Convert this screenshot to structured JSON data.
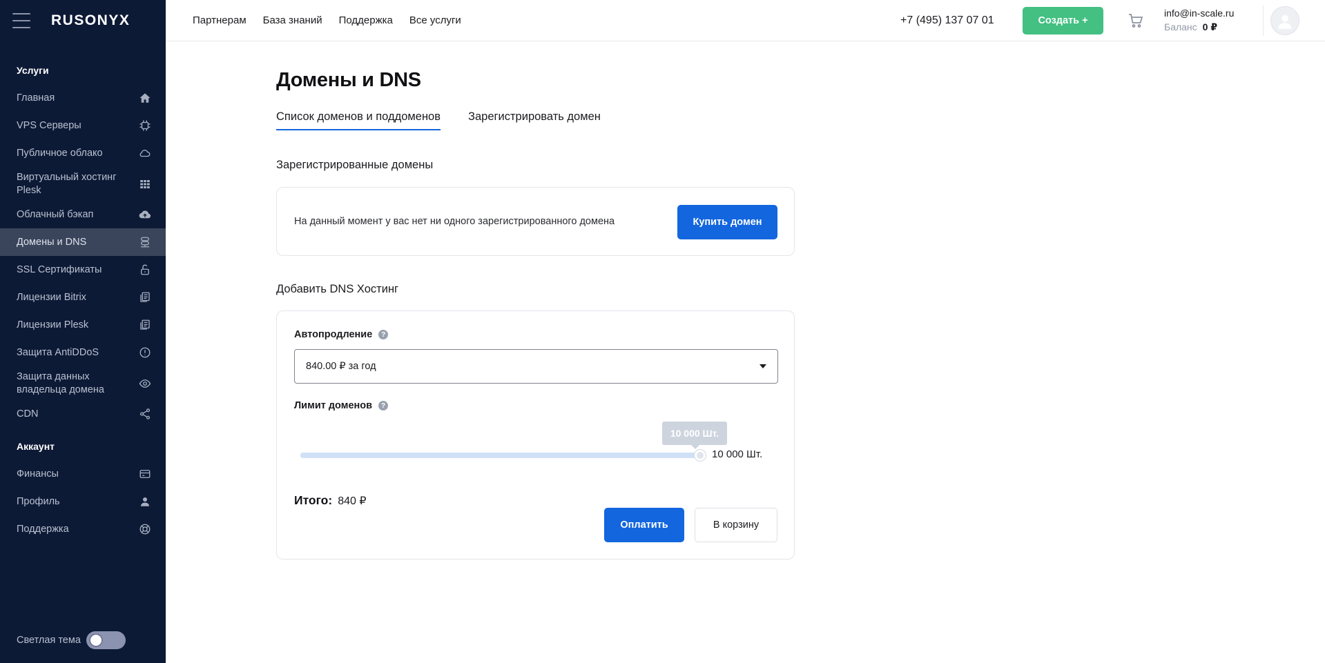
{
  "brand": {
    "logo": "RUSONYX"
  },
  "sidebar": {
    "services_title": "Услуги",
    "services": [
      {
        "label": "Главная",
        "icon": "home-icon"
      },
      {
        "label": "VPS Серверы",
        "icon": "cpu-icon"
      },
      {
        "label": "Публичное облако",
        "icon": "cloud-icon"
      },
      {
        "label": "Виртуальный хостинг Plesk",
        "icon": "grid-icon"
      },
      {
        "label": "Облачный бэкап",
        "icon": "cloud-upload-icon"
      },
      {
        "label": "Домены и DNS",
        "icon": "dns-icon",
        "active": true
      },
      {
        "label": "SSL Сертификаты",
        "icon": "lock-icon"
      },
      {
        "label": "Лицензии Bitrix",
        "icon": "license-icon"
      },
      {
        "label": "Лицензии Plesk",
        "icon": "license-icon"
      },
      {
        "label": "Защита AntiDDoS",
        "icon": "alert-circle-icon"
      },
      {
        "label": "Защита данных владельца домена",
        "icon": "eye-icon"
      },
      {
        "label": "CDN",
        "icon": "share-icon"
      }
    ],
    "account_title": "Аккаунт",
    "account": [
      {
        "label": "Финансы",
        "icon": "card-icon"
      },
      {
        "label": "Профиль",
        "icon": "user-icon"
      },
      {
        "label": "Поддержка",
        "icon": "lifebuoy-icon"
      }
    ],
    "theme_label": "Светлая тема",
    "theme_toggle_on": false
  },
  "topbar": {
    "nav": [
      "Партнерам",
      "База знаний",
      "Поддержка",
      "Все услуги"
    ],
    "phone": "+7 (495) 137 07 01",
    "create_label": "Создать +",
    "email": "info@in-scale.ru",
    "balance_label": "Баланс",
    "balance_value": "0 ₽"
  },
  "page": {
    "title": "Домены и DNS",
    "tabs": [
      {
        "label": "Список доменов и поддоменов",
        "active": true
      },
      {
        "label": "Зарегистрировать домен",
        "active": false
      }
    ],
    "registered": {
      "title": "Зарегистрированные домены",
      "message": "На данный момент у вас нет ни одного зарегистрированного домена",
      "buy_label": "Купить домен"
    },
    "dns_hosting": {
      "title": "Добавить DNS Хостинг",
      "autorenew_label": "Автопродление",
      "autorenew_value": "840.00 ₽ за год",
      "limit_label": "Лимит доменов",
      "slider_fraction": 1.0,
      "slider_tooltip": "10 000 Шт.",
      "slider_value": "10 000 Шт.",
      "total_label": "Итого:",
      "total_value": "840 ₽",
      "pay_label": "Оплатить",
      "cart_label": "В корзину"
    }
  }
}
